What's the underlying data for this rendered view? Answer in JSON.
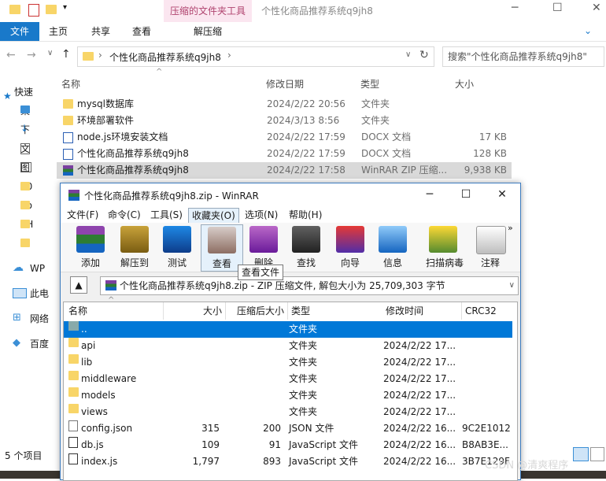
{
  "explorer": {
    "title": "个性化商品推荐系统q9jh8",
    "ribbon_context": "压缩的文件夹工具",
    "ribbon_context_tab": "解压缩",
    "tabs": [
      "文件",
      "主页",
      "共享",
      "查看"
    ],
    "address_folder": "个性化商品推荐系统q9jh8",
    "search_placeholder": "搜索\"个性化商品推荐系统q9jh8\"",
    "columns": {
      "name": "名称",
      "date": "修改日期",
      "type": "类型",
      "size": "大小"
    },
    "rows": [
      {
        "name": "mysql数据库",
        "date": "2024/2/22 20:56",
        "type": "文件夹",
        "size": ""
      },
      {
        "name": "环境部署软件",
        "date": "2024/3/13 8:56",
        "type": "文件夹",
        "size": ""
      },
      {
        "name": "node.js环境安装文档",
        "date": "2024/2/22 17:59",
        "type": "DOCX 文档",
        "size": "17 KB"
      },
      {
        "name": "个性化商品推荐系统q9jh8",
        "date": "2024/2/22 17:59",
        "type": "DOCX 文档",
        "size": "128 KB"
      },
      {
        "name": "个性化商品推荐系统q9jh8",
        "date": "2024/2/22 17:58",
        "type": "WinRAR ZIP 压缩...",
        "size": "9,938 KB"
      }
    ],
    "nav": [
      "快速",
      "桌",
      "下",
      "文",
      "图",
      "20",
      "no",
      "PH",
      "个",
      "WP",
      "此电",
      "网络",
      "百度"
    ],
    "status": "5 个项目"
  },
  "winrar": {
    "title": "个性化商品推荐系统q9jh8.zip - WinRAR",
    "menu": [
      "文件(F)",
      "命令(C)",
      "工具(S)",
      "收藏夹(O)",
      "选项(N)",
      "帮助(H)"
    ],
    "toolbar": [
      "添加",
      "解压到",
      "测试",
      "查看",
      "删除",
      "查找",
      "向导",
      "信息",
      "扫描病毒",
      "注释"
    ],
    "tooltip": "查看文件",
    "path": "个性化商品推荐系统q9jh8.zip - ZIP 压缩文件, 解包大小为 25,709,303 字节",
    "columns": {
      "name": "名称",
      "size": "大小",
      "packed": "压缩后大小",
      "type": "类型",
      "modified": "修改时间",
      "crc": "CRC32"
    },
    "rows": [
      {
        "name": "..",
        "size": "",
        "packed": "",
        "type": "文件夹",
        "modified": "",
        "crc": ""
      },
      {
        "name": "api",
        "size": "",
        "packed": "",
        "type": "文件夹",
        "modified": "2024/2/22 17...",
        "crc": ""
      },
      {
        "name": "lib",
        "size": "",
        "packed": "",
        "type": "文件夹",
        "modified": "2024/2/22 17...",
        "crc": ""
      },
      {
        "name": "middleware",
        "size": "",
        "packed": "",
        "type": "文件夹",
        "modified": "2024/2/22 17...",
        "crc": ""
      },
      {
        "name": "models",
        "size": "",
        "packed": "",
        "type": "文件夹",
        "modified": "2024/2/22 17...",
        "crc": ""
      },
      {
        "name": "views",
        "size": "",
        "packed": "",
        "type": "文件夹",
        "modified": "2024/2/22 17...",
        "crc": ""
      },
      {
        "name": "config.json",
        "size": "315",
        "packed": "200",
        "type": "JSON 文件",
        "modified": "2024/2/22 16...",
        "crc": "9C2E1012"
      },
      {
        "name": "db.js",
        "size": "109",
        "packed": "91",
        "type": "JavaScript 文件",
        "modified": "2024/2/22 16...",
        "crc": "B8AB3E..."
      },
      {
        "name": "index.js",
        "size": "1,797",
        "packed": "893",
        "type": "JavaScript 文件",
        "modified": "2024/2/22 16...",
        "crc": "3B7E129F"
      }
    ]
  },
  "watermark": "CSDN @清爽程序"
}
